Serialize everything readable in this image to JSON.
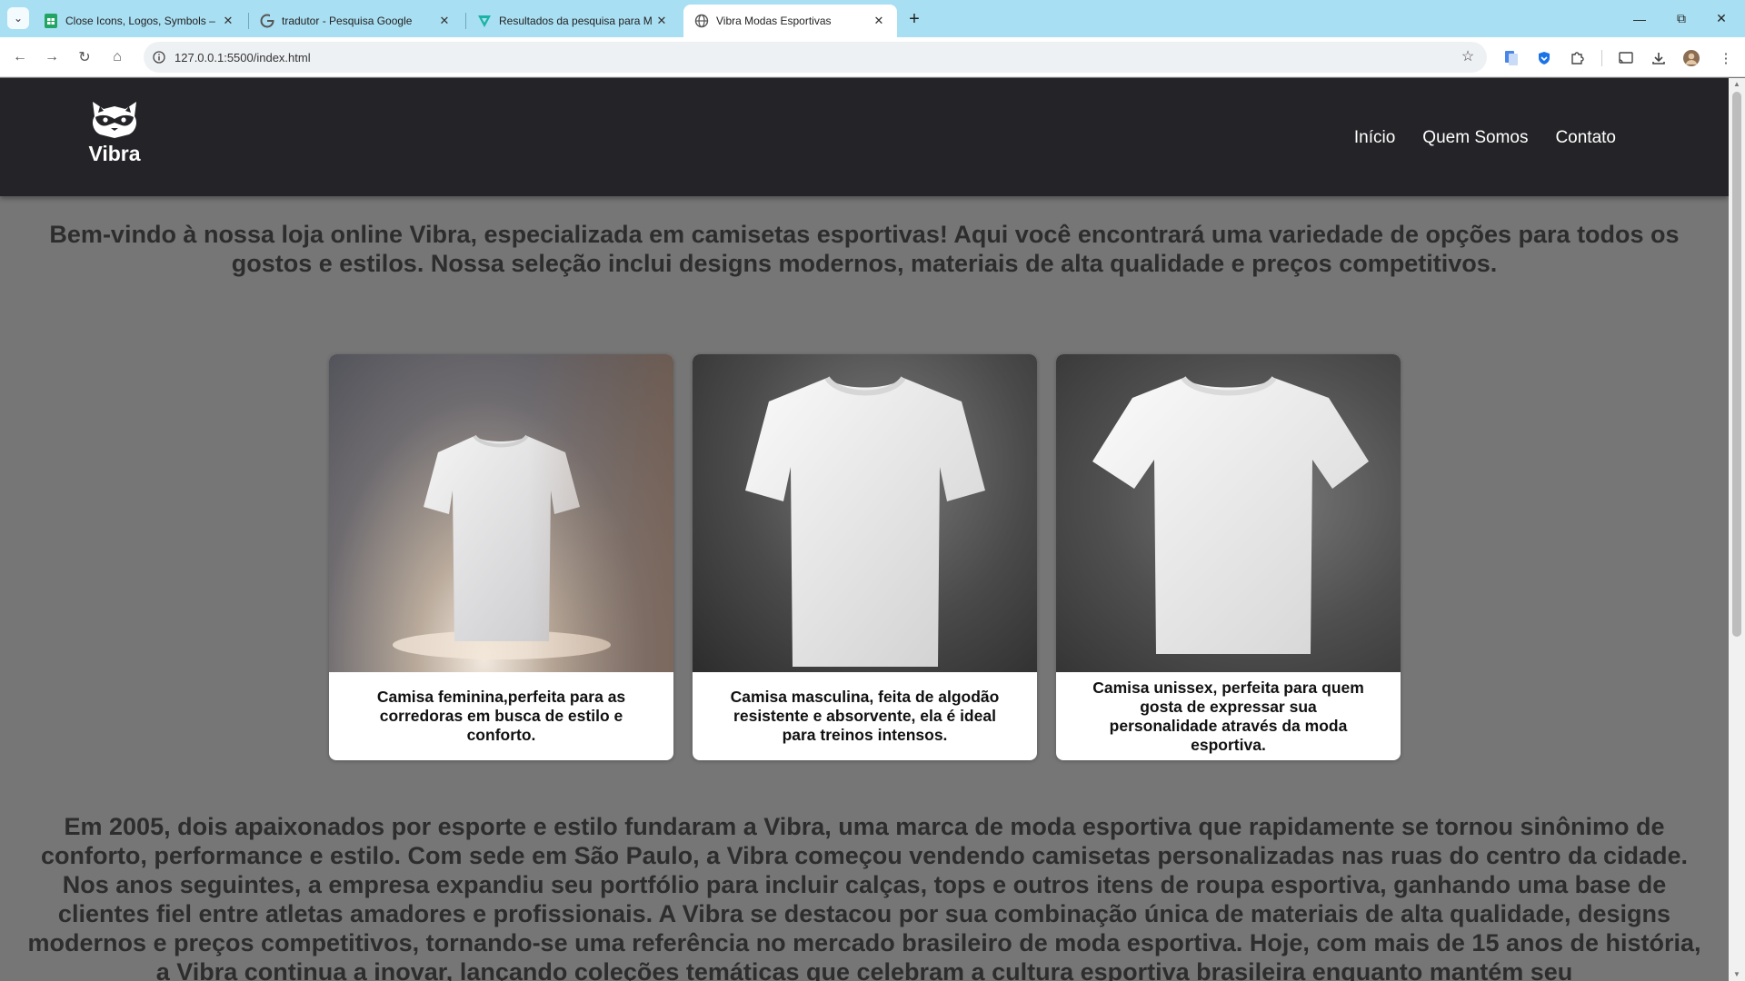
{
  "browser": {
    "tabs": [
      {
        "title": "Close Icons, Logos, Symbols – F",
        "icon": "sheets-icon",
        "active": false
      },
      {
        "title": "tradutor - Pesquisa Google",
        "icon": "google-icon",
        "active": false
      },
      {
        "title": "Resultados da pesquisa para M",
        "icon": "vectorizer-icon",
        "active": false
      },
      {
        "title": "Vibra Modas Esportivas",
        "icon": "globe-icon",
        "active": true
      }
    ],
    "url": "127.0.0.1:5500/index.html",
    "accent": "#a9dff2"
  },
  "site": {
    "brand": "Vibra",
    "nav": [
      "Início",
      "Quem Somos",
      "Contato"
    ],
    "header_bg": "#242428",
    "page_bg": "#767676",
    "intro": "Bem-vindo à nossa loja online Vibra, especializada em camisetas esportivas! Aqui você encontrará uma variedade de opções para todos os gostos e estilos. Nossa seleção inclui designs modernos, materiais de alta qualidade e preços competitivos.",
    "products": [
      {
        "caption": "Camisa feminina,perfeita para as corredoras em busca de estilo e conforto."
      },
      {
        "caption": "Camisa masculina, feita de algodão resistente e absorvente, ela é ideal para treinos intensos."
      },
      {
        "caption": "Camisa unissex, perfeita para quem gosta de expressar sua personalidade através da moda esportiva."
      }
    ],
    "about": "Em 2005, dois apaixonados por esporte e estilo fundaram a Vibra, uma marca de moda esportiva que rapidamente se tornou sinônimo de conforto, performance e estilo. Com sede em São Paulo, a Vibra começou vendendo camisetas personalizadas nas ruas do centro da cidade. Nos anos seguintes, a empresa expandiu seu portfólio para incluir calças, tops e outros itens de roupa esportiva, ganhando uma base de clientes fiel entre atletas amadores e profissionais. A Vibra se destacou por sua combinação única de materiais de alta qualidade, designs modernos e preços competitivos, tornando-se uma referência no mercado brasileiro de moda esportiva. Hoje, com mais de 15 anos de história, a Vibra continua a inovar, lançando coleções temáticas que celebram a cultura esportiva brasileira enquanto mantém seu"
  }
}
